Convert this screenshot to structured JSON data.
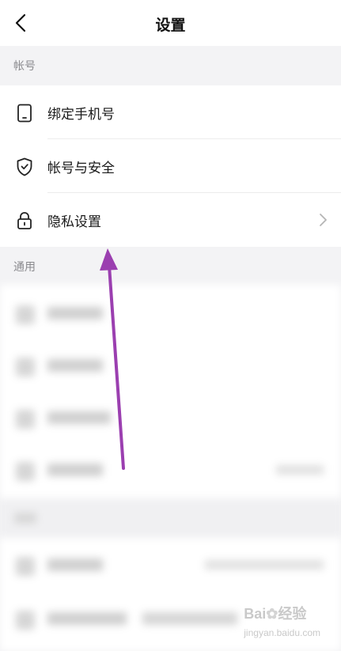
{
  "header": {
    "title": "设置"
  },
  "sections": {
    "account": {
      "title": "帐号"
    },
    "general": {
      "title": "通用"
    }
  },
  "account_items": [
    {
      "label": "绑定手机号",
      "icon": "phone-icon"
    },
    {
      "label": "帐号与安全",
      "icon": "shield-icon"
    },
    {
      "label": "隐私设置",
      "icon": "lock-icon"
    }
  ],
  "watermark": {
    "text": "Bai",
    "suffix": "经验",
    "sub": "jingyan.baidu.com"
  },
  "colors": {
    "arrow": "#9b3fb0",
    "background": "#f3f3f5",
    "card": "#ffffff"
  }
}
